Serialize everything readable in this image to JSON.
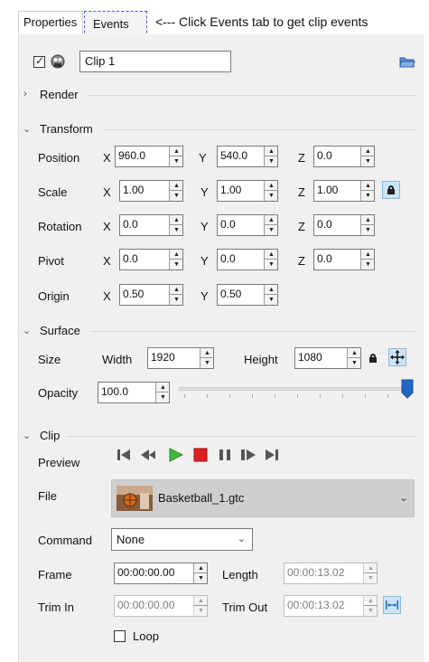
{
  "tabs": {
    "properties": "Properties",
    "events": "Events"
  },
  "annotation": "<--- Click Events tab to get clip events",
  "clip": {
    "name": "Clip 1",
    "enabled": true
  },
  "sections": {
    "render": "Render",
    "transform": "Transform",
    "surface": "Surface",
    "clip": "Clip"
  },
  "axes": {
    "x": "X",
    "y": "Y",
    "z": "Z"
  },
  "transform": {
    "position": {
      "label": "Position",
      "x": "960.0",
      "y": "540.0",
      "z": "0.0"
    },
    "scale": {
      "label": "Scale",
      "x": "1.00",
      "y": "1.00",
      "z": "1.00"
    },
    "rotation": {
      "label": "Rotation",
      "x": "0.0",
      "y": "0.0",
      "z": "0.0"
    },
    "pivot": {
      "label": "Pivot",
      "x": "0.0",
      "y": "0.0",
      "z": "0.0"
    },
    "origin": {
      "label": "Origin",
      "x": "0.50",
      "y": "0.50"
    }
  },
  "surface": {
    "size_label": "Size",
    "width_label": "Width",
    "width": "1920",
    "height_label": "Height",
    "height": "1080",
    "opacity_label": "Opacity",
    "opacity": "100.0",
    "opacity_fraction": 1.0
  },
  "clip_section": {
    "preview_label": "Preview",
    "file_label": "File",
    "file_name": "Basketball_1.gtc",
    "command_label": "Command",
    "command_value": "None",
    "frame_label": "Frame",
    "frame_value": "00:00:00.00",
    "length_label": "Length",
    "length_value": "00:00:13.02",
    "trim_in_label": "Trim In",
    "trim_in_value": "00:00:00.00",
    "trim_out_label": "Trim Out",
    "trim_out_value": "00:00:13.02",
    "loop_label": "Loop",
    "loop_checked": false
  },
  "colors": {
    "accent_blue": "#1f66c7",
    "play_green": "#3fb83f",
    "stop_red": "#e02020",
    "media_gray": "#555555"
  }
}
